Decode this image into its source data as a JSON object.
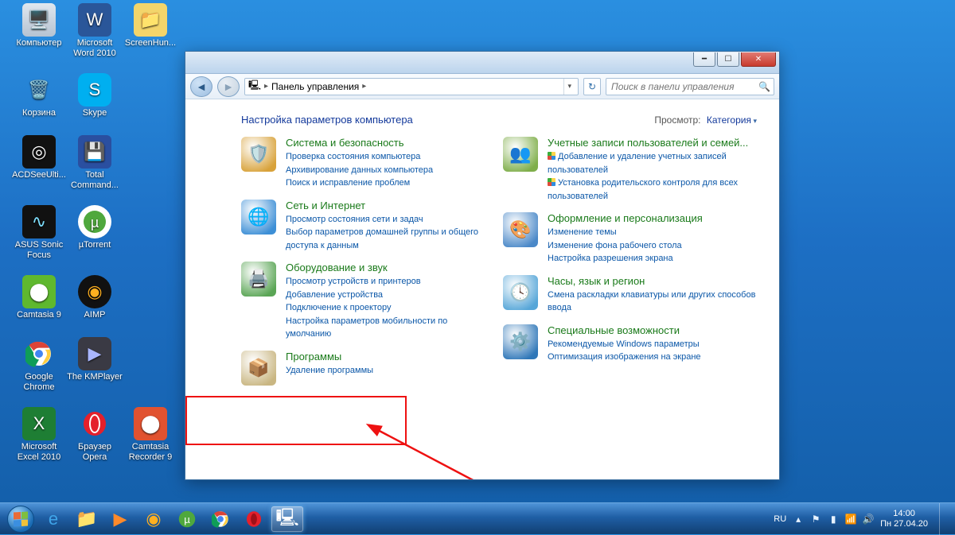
{
  "desktop": {
    "icons": [
      {
        "label": "Компьютер"
      },
      {
        "label": "Microsoft Word 2010"
      },
      {
        "label": "ScreenHun..."
      },
      {
        "label": "Корзина"
      },
      {
        "label": "Skype"
      },
      {
        "label": "ACDSeeUlti..."
      },
      {
        "label": "Total Command..."
      },
      {
        "label": "ASUS Sonic Focus"
      },
      {
        "label": "µTorrent"
      },
      {
        "label": "Camtasia 9"
      },
      {
        "label": "AIMP"
      },
      {
        "label": "Google Chrome"
      },
      {
        "label": "The KMPlayer"
      },
      {
        "label": "Microsoft Excel 2010"
      },
      {
        "label": "Браузер Opera"
      },
      {
        "label": "Camtasia Recorder 9"
      }
    ]
  },
  "window": {
    "breadcrumb_root": "Панель управления",
    "search_placeholder": "Поиск в панели управления",
    "heading": "Настройка параметров компьютера",
    "view_label": "Просмотр:",
    "view_value": "Категория",
    "left": [
      {
        "title": "Система и безопасность",
        "links": [
          "Проверка состояния компьютера",
          "Архивирование данных компьютера",
          "Поиск и исправление проблем"
        ],
        "color": "#d8a23a"
      },
      {
        "title": "Сеть и Интернет",
        "links": [
          "Просмотр состояния сети и задач",
          "Выбор параметров домашней группы и общего доступа к данным"
        ],
        "color": "#3d8fd6"
      },
      {
        "title": "Оборудование и звук",
        "links": [
          "Просмотр устройств и принтеров",
          "Добавление устройства",
          "Подключение к проектору",
          "Настройка параметров мобильности по умолчанию"
        ],
        "color": "#5aa555"
      },
      {
        "title": "Программы",
        "links": [
          "Удаление программы"
        ],
        "color": "#c9b682"
      }
    ],
    "right": [
      {
        "title": "Учетные записи пользователей и семей...",
        "links": [
          "Добавление и удаление учетных записей пользователей",
          "Установка родительского контроля для всех пользователей"
        ],
        "shields": [
          0,
          1
        ],
        "color": "#7fae4a"
      },
      {
        "title": "Оформление и персонализация",
        "links": [
          "Изменение темы",
          "Изменение фона рабочего стола",
          "Настройка разрешения экрана"
        ],
        "color": "#4a88c8"
      },
      {
        "title": "Часы, язык и регион",
        "links": [
          "Смена раскладки клавиатуры или других способов ввода"
        ],
        "color": "#56a6d8"
      },
      {
        "title": "Специальные возможности",
        "links": [
          "Рекомендуемые Windows параметры",
          "Оптимизация изображения на экране"
        ],
        "color": "#2f77b8"
      }
    ]
  },
  "taskbar": {
    "lang": "RU",
    "time": "14:00",
    "date": "Пн 27.04.20"
  }
}
